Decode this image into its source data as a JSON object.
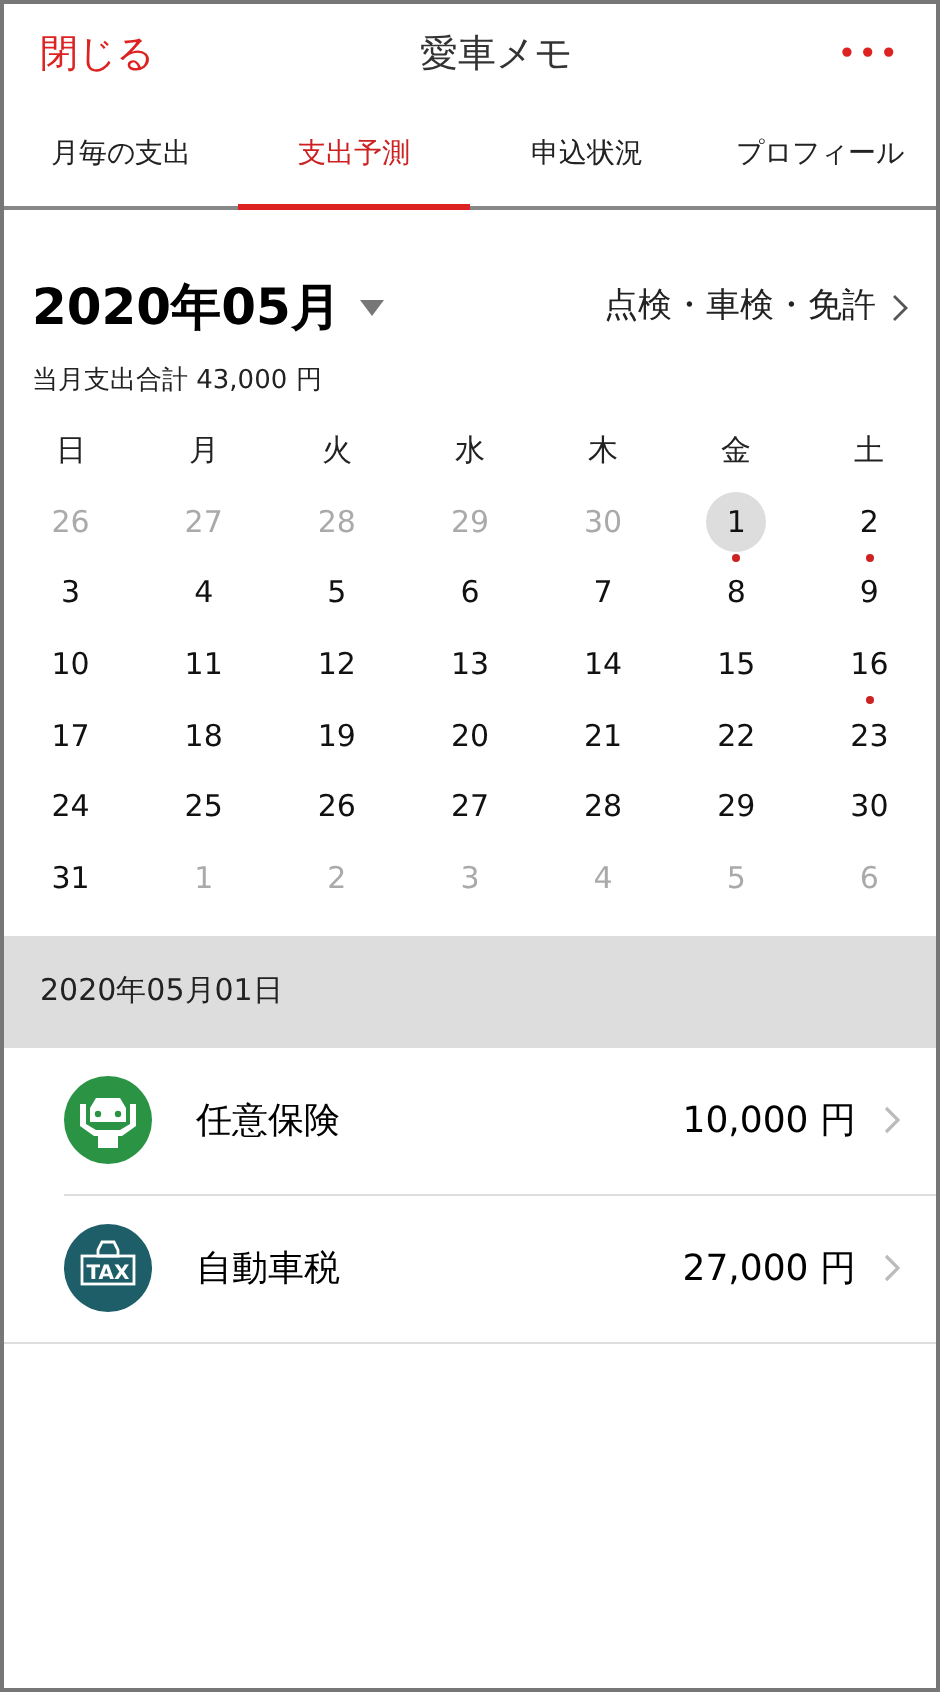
{
  "header": {
    "close": "閉じる",
    "title": "愛車メモ",
    "more": "•••"
  },
  "tabs": [
    {
      "label": "月毎の支出",
      "selected": false
    },
    {
      "label": "支出予測",
      "selected": true
    },
    {
      "label": "申込状況",
      "selected": false
    },
    {
      "label": "プロフィール",
      "selected": false
    }
  ],
  "month": {
    "title": "2020年05月",
    "link": "点検・車検・免許",
    "total": "当月支出合計 43,000 円"
  },
  "weekdays": [
    "日",
    "月",
    "火",
    "水",
    "木",
    "金",
    "土"
  ],
  "days": [
    {
      "label": "26",
      "in_month": false,
      "selected": false,
      "marked": false
    },
    {
      "label": "27",
      "in_month": false,
      "selected": false,
      "marked": false
    },
    {
      "label": "28",
      "in_month": false,
      "selected": false,
      "marked": false
    },
    {
      "label": "29",
      "in_month": false,
      "selected": false,
      "marked": false
    },
    {
      "label": "30",
      "in_month": false,
      "selected": false,
      "marked": false
    },
    {
      "label": "1",
      "in_month": true,
      "selected": true,
      "marked": true
    },
    {
      "label": "2",
      "in_month": true,
      "selected": false,
      "marked": true
    },
    {
      "label": "3",
      "in_month": true,
      "selected": false,
      "marked": false
    },
    {
      "label": "4",
      "in_month": true,
      "selected": false,
      "marked": false
    },
    {
      "label": "5",
      "in_month": true,
      "selected": false,
      "marked": false
    },
    {
      "label": "6",
      "in_month": true,
      "selected": false,
      "marked": false
    },
    {
      "label": "7",
      "in_month": true,
      "selected": false,
      "marked": false
    },
    {
      "label": "8",
      "in_month": true,
      "selected": false,
      "marked": false
    },
    {
      "label": "9",
      "in_month": true,
      "selected": false,
      "marked": false
    },
    {
      "label": "10",
      "in_month": true,
      "selected": false,
      "marked": false
    },
    {
      "label": "11",
      "in_month": true,
      "selected": false,
      "marked": false
    },
    {
      "label": "12",
      "in_month": true,
      "selected": false,
      "marked": false
    },
    {
      "label": "13",
      "in_month": true,
      "selected": false,
      "marked": false
    },
    {
      "label": "14",
      "in_month": true,
      "selected": false,
      "marked": false
    },
    {
      "label": "15",
      "in_month": true,
      "selected": false,
      "marked": false
    },
    {
      "label": "16",
      "in_month": true,
      "selected": false,
      "marked": true
    },
    {
      "label": "17",
      "in_month": true,
      "selected": false,
      "marked": false
    },
    {
      "label": "18",
      "in_month": true,
      "selected": false,
      "marked": false
    },
    {
      "label": "19",
      "in_month": true,
      "selected": false,
      "marked": false
    },
    {
      "label": "20",
      "in_month": true,
      "selected": false,
      "marked": false
    },
    {
      "label": "21",
      "in_month": true,
      "selected": false,
      "marked": false
    },
    {
      "label": "22",
      "in_month": true,
      "selected": false,
      "marked": false
    },
    {
      "label": "23",
      "in_month": true,
      "selected": false,
      "marked": false
    },
    {
      "label": "24",
      "in_month": true,
      "selected": false,
      "marked": false
    },
    {
      "label": "25",
      "in_month": true,
      "selected": false,
      "marked": false
    },
    {
      "label": "26",
      "in_month": true,
      "selected": false,
      "marked": false
    },
    {
      "label": "27",
      "in_month": true,
      "selected": false,
      "marked": false
    },
    {
      "label": "28",
      "in_month": true,
      "selected": false,
      "marked": false
    },
    {
      "label": "29",
      "in_month": true,
      "selected": false,
      "marked": false
    },
    {
      "label": "30",
      "in_month": true,
      "selected": false,
      "marked": false
    },
    {
      "label": "31",
      "in_month": true,
      "selected": false,
      "marked": false
    },
    {
      "label": "1",
      "in_month": false,
      "selected": false,
      "marked": false
    },
    {
      "label": "2",
      "in_month": false,
      "selected": false,
      "marked": false
    },
    {
      "label": "3",
      "in_month": false,
      "selected": false,
      "marked": false
    },
    {
      "label": "4",
      "in_month": false,
      "selected": false,
      "marked": false
    },
    {
      "label": "5",
      "in_month": false,
      "selected": false,
      "marked": false
    },
    {
      "label": "6",
      "in_month": false,
      "selected": false,
      "marked": false
    }
  ],
  "date_header": "2020年05月01日",
  "expenses": [
    {
      "kind": "insurance",
      "name": "任意保険",
      "amount": "10,000 円"
    },
    {
      "kind": "tax",
      "name": "自動車税",
      "amount": "27,000 円",
      "icon_text": "TAX"
    }
  ]
}
